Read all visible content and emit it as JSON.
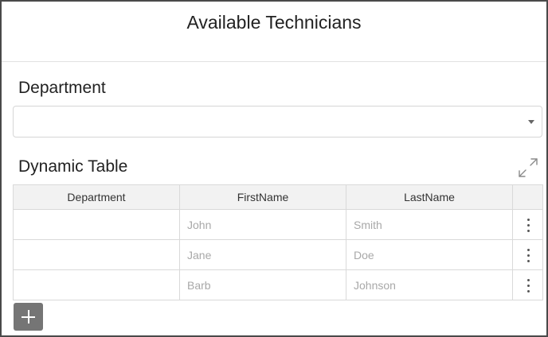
{
  "header": {
    "title": "Available Technicians"
  },
  "department_field": {
    "label": "Department",
    "value": ""
  },
  "table": {
    "title": "Dynamic Table",
    "columns": [
      "Department",
      "FirstName",
      "LastName",
      ""
    ],
    "rows": [
      {
        "department": "",
        "first_name": "John",
        "last_name": "Smith"
      },
      {
        "department": "",
        "first_name": "Jane",
        "last_name": "Doe"
      },
      {
        "department": "",
        "first_name": "Barb",
        "last_name": "Johnson"
      }
    ]
  },
  "icons": {
    "expand": "expand-icon",
    "row_menu": "more-vertical-icon",
    "add": "plus-icon",
    "dropdown": "chevron-down-icon"
  },
  "colors": {
    "border": "#d9d9d9",
    "header_bg": "#f2f2f2",
    "placeholder_text": "#a8a8a8",
    "add_button": "#757575",
    "frame": "#4a4a4a"
  }
}
